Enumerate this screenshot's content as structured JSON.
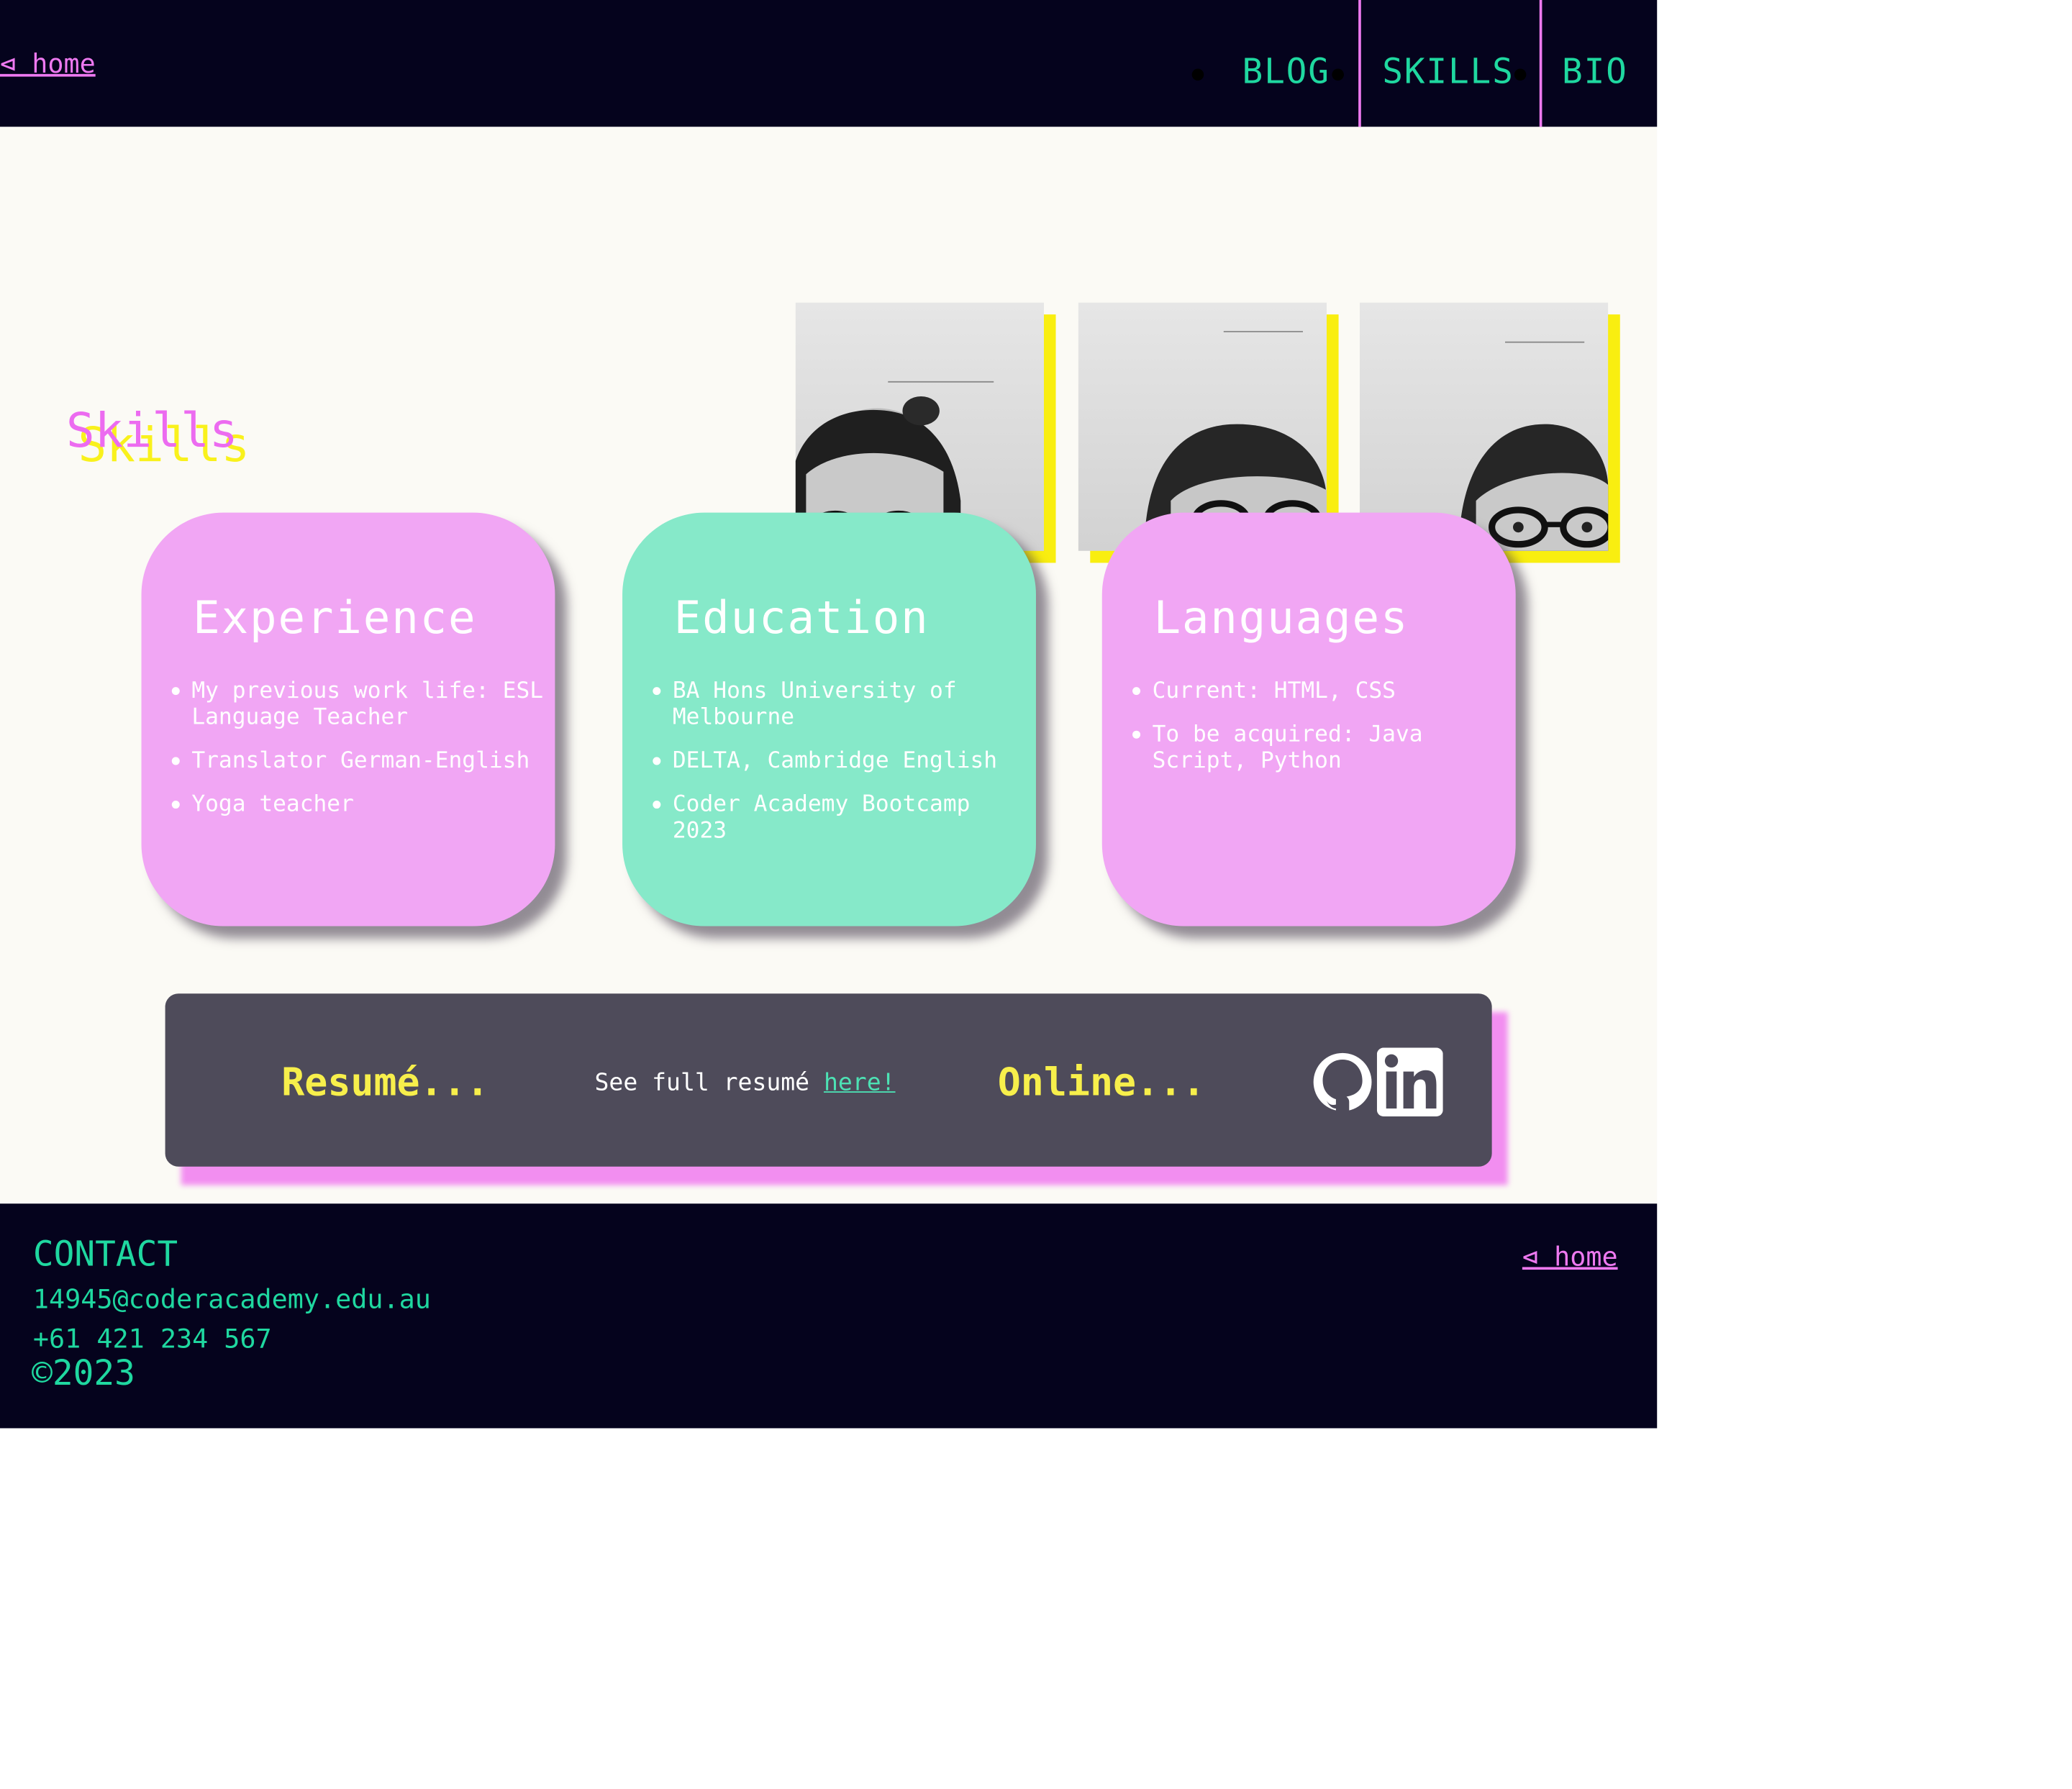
{
  "header": {
    "home_link": "⊲ home",
    "nav": [
      {
        "label": "BLOG"
      },
      {
        "label": "SKILLS"
      },
      {
        "label": "BIO"
      }
    ]
  },
  "page": {
    "title": "Skills"
  },
  "colors": {
    "navy": "#05031d",
    "teal": "#1fd8a0",
    "pink": "#ee79f0",
    "yellow": "#f9ee10",
    "card_pink": "#f1a6f4",
    "card_teal": "#86e9c9",
    "banner": "#4e4b5a"
  },
  "cards": [
    {
      "title": "Experience",
      "items": [
        "My previous work life: ESL Language Teacher",
        "Translator German-English",
        "Yoga teacher"
      ]
    },
    {
      "title": "Education",
      "items": [
        "BA Hons University of Melbourne",
        "DELTA, Cambridge English",
        "Coder Academy Bootcamp 2023"
      ]
    },
    {
      "title": "Languages",
      "items": [
        "Current: HTML, CSS",
        "To be acquired: Java Script, Python"
      ]
    }
  ],
  "banner": {
    "resume_heading": "Resumé...",
    "see_text": "See full resumé ",
    "link_text": "here!",
    "online_heading": "Online...",
    "icons": [
      "github-icon",
      "linkedin-icon"
    ]
  },
  "footer": {
    "contact_heading": "CONTACT",
    "email": "14945@coderacademy.edu.au",
    "phone": "+61 421 234 567",
    "copyright": "©2023",
    "home_link": "⊲ home"
  }
}
